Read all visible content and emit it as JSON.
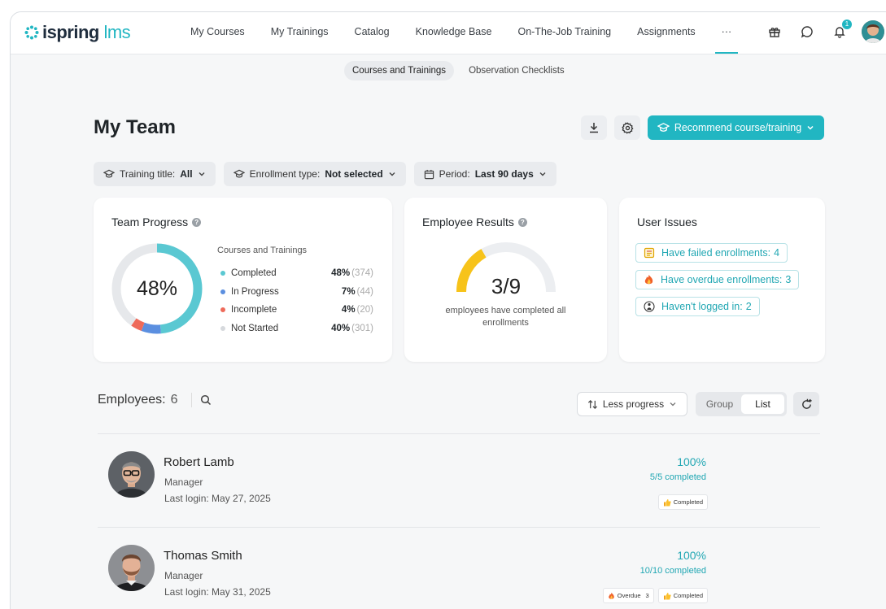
{
  "brand": {
    "name": "ispring",
    "suffix": "lms",
    "accent": "#21b6c2"
  },
  "nav": {
    "items": [
      "My Courses",
      "My Trainings",
      "Catalog",
      "Knowledge Base",
      "On-The-Job Training",
      "Assignments",
      "···"
    ],
    "notification_count": "1"
  },
  "subtabs": [
    "Courses and Trainings",
    "Observation Checklists"
  ],
  "page": {
    "title": "My Team",
    "recommend_label": "Recommend course/training"
  },
  "filters": [
    {
      "label": "Training title:",
      "value": "All"
    },
    {
      "label": "Enrollment type:",
      "value": "Not selected"
    },
    {
      "label": "Period:",
      "value": "Last 90 days"
    }
  ],
  "team_progress": {
    "title": "Team Progress",
    "center_label": "48%",
    "legend_title": "Courses and Trainings",
    "rows": [
      {
        "label": "Completed",
        "pct": "48%",
        "count": "(374)",
        "color": "#5ac8d2",
        "value": 48
      },
      {
        "label": "In Progress",
        "pct": "7%",
        "count": "(44)",
        "color": "#5b8fe0",
        "value": 7
      },
      {
        "label": "Incomplete",
        "pct": "4%",
        "count": "(20)",
        "color": "#ee6a5a",
        "value": 4
      },
      {
        "label": "Not Started",
        "pct": "40%",
        "count": "(301)",
        "color": "#e6e8eb",
        "value": 40
      }
    ]
  },
  "employee_results": {
    "title": "Employee Results",
    "value": "3/9",
    "caption_line1": "employees have completed all",
    "caption_line2": "enrollments",
    "completed": 3,
    "total": 9
  },
  "user_issues": {
    "title": "User Issues",
    "items": [
      {
        "label": "Have failed enrollments:",
        "count": "4",
        "icon": "failed-list-icon"
      },
      {
        "label": "Have overdue enrollments:",
        "count": "3",
        "icon": "fire-icon"
      },
      {
        "label": "Haven't logged in:",
        "count": "2",
        "icon": "person-icon"
      }
    ]
  },
  "employees": {
    "label": "Employees:",
    "count": "6",
    "sort_label": "Less progress",
    "view_group": "Group",
    "view_list": "List",
    "rows": [
      {
        "name": "Robert Lamb",
        "role": "Manager",
        "last_login": "Last login: May 27, 2025",
        "pct": "100%",
        "done": "5/5 completed",
        "tags": [
          {
            "label": "Completed",
            "icon": "thumbs-up-icon"
          }
        ]
      },
      {
        "name": "Thomas Smith",
        "role": "Manager",
        "last_login": "Last login: May 31, 2025",
        "pct": "100%",
        "done": "10/10 completed",
        "tags": [
          {
            "label": "Overdue",
            "count": "3",
            "icon": "fire-icon"
          },
          {
            "label": "Completed",
            "icon": "thumbs-up-icon"
          }
        ]
      }
    ]
  }
}
